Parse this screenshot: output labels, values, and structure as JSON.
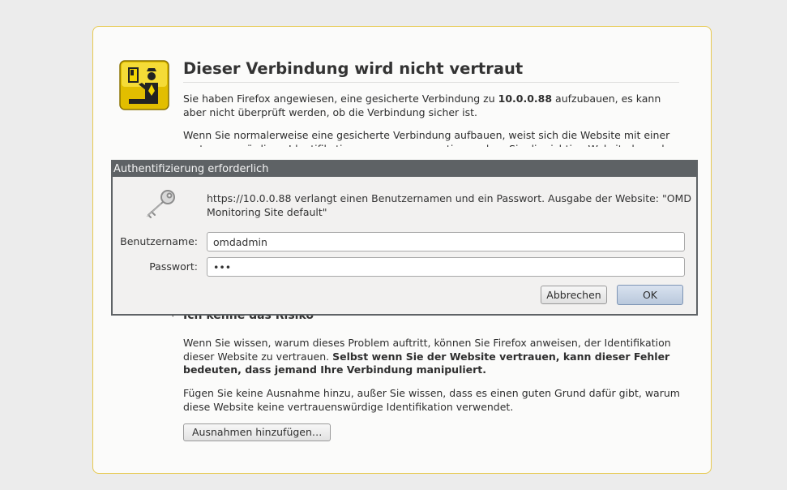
{
  "error_page": {
    "title": "Dieser Verbindung wird nicht vertraut",
    "para1_prefix": "Sie haben Firefox angewiesen, eine gesicherte Verbindung zu ",
    "para1_host": "10.0.0.88",
    "para1_suffix": " aufzubauen, es kann aber nicht überprüft werden, ob die Verbindung sicher ist.",
    "para2": "Wenn Sie normalerweise eine gesicherte Verbindung aufbauen, weist sich die Website mit einer vertrauenswürdigen Identifikation aus, um zu garantieren, dass Sie die richtige Website besuchen. Die Identifikation dieser Website dagegen kann nicht bestätigt werden.",
    "risk_heading": "Ich kenne das Risiko",
    "para3_prefix": "Wenn Sie wissen, warum dieses Problem auftritt, können Sie Firefox anweisen, der Identifikation dieser Website zu vertrauen. ",
    "para3_bold": "Selbst wenn Sie der Website vertrauen, kann dieser Fehler bedeuten, dass jemand Ihre Verbindung manipuliert.",
    "para4": "Fügen Sie keine Ausnahme hinzu, außer Sie wissen, dass es einen guten Grund dafür gibt, warum diese Website keine vertrauenswürdige Identifikation verwendet.",
    "add_exception_label": "Ausnahmen hinzufügen…",
    "icon": "certificate-warning-icon"
  },
  "auth_dialog": {
    "title": "Authentifizierung erforderlich",
    "message": "https://10.0.0.88 verlangt einen Benutzernamen und ein Passwort. Ausgabe der Website: \"OMD Monitoring Site default\"",
    "username_label": "Benutzername:",
    "username_value": "omdadmin",
    "password_label": "Passwort:",
    "password_value": "•••",
    "cancel_label": "Abbrechen",
    "ok_label": "OK",
    "icon": "key-icon"
  },
  "colors": {
    "box_border": "#e7c94f",
    "icon_yellow": "#f2d000",
    "dialog_titlebar": "#5e6265",
    "ok_button": "#c8d4e6"
  }
}
